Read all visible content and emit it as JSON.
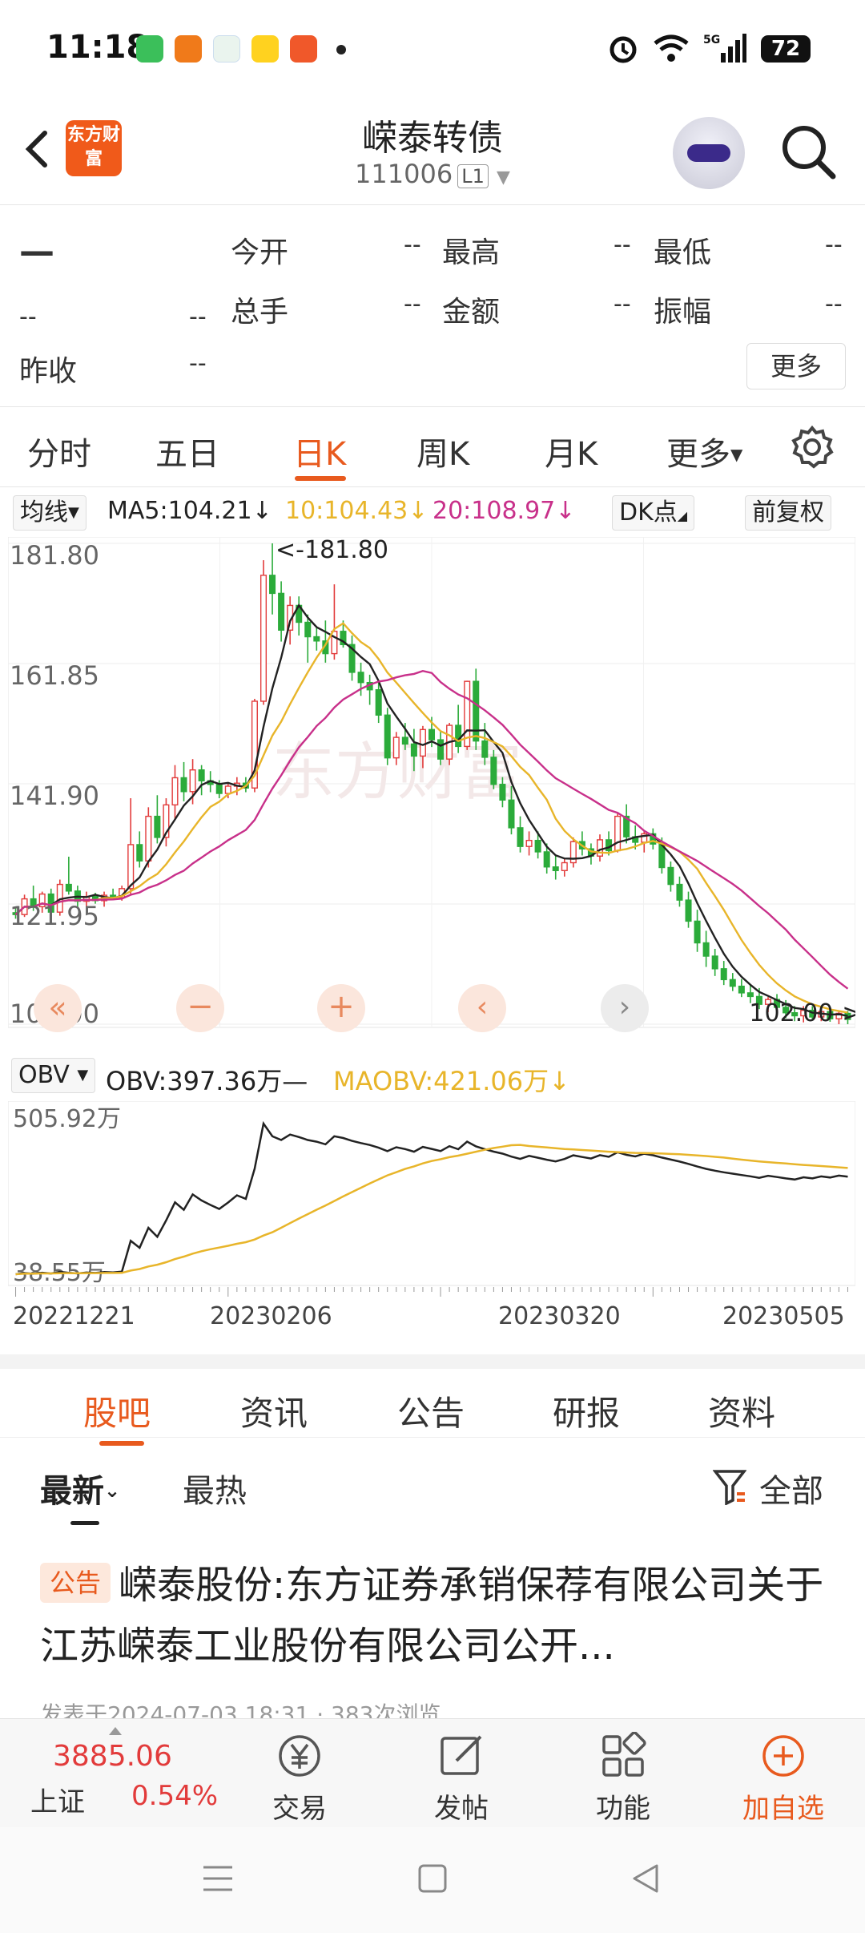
{
  "status": {
    "time": "11:18",
    "battery": "72",
    "network": "5G"
  },
  "header": {
    "title": "嵘泰转债",
    "code": "111006",
    "level": "L1",
    "logo_text": "东方财富"
  },
  "quote": {
    "price": "—",
    "change": "--",
    "change_pct": "--",
    "prev_close_label": "昨收",
    "prev_close": "--",
    "fields": [
      {
        "label": "今开",
        "value": "--"
      },
      {
        "label": "最高",
        "value": "--"
      },
      {
        "label": "最低",
        "value": "--"
      },
      {
        "label": "总手",
        "value": "--"
      },
      {
        "label": "金额",
        "value": "--"
      },
      {
        "label": "振幅",
        "value": "--"
      }
    ],
    "more_label": "更多"
  },
  "tabs": [
    "分时",
    "五日",
    "日K",
    "周K",
    "月K",
    "更多"
  ],
  "active_tab": "日K",
  "ma": {
    "selector": "均线",
    "ma5": "MA5:104.21",
    "ma10": "10:104.43",
    "ma20": "20:108.97",
    "dk": "DK点",
    "adjust": "前复权",
    "colors": {
      "ma5": "#222222",
      "ma10": "#e8b52a",
      "ma20": "#c8308a",
      "up": "#e23b3b",
      "down": "#2bab3a"
    }
  },
  "obv": {
    "selector": "OBV",
    "obv_text": "OBV:397.36万",
    "maobv_text": "MAOBV:421.06万",
    "y_top": "505.92万",
    "y_bottom": "38.55万"
  },
  "chart_data": {
    "type": "candlestick",
    "y_ticks": [
      "181.80",
      "161.85",
      "141.90",
      "121.95",
      "102.00"
    ],
    "ylim": [
      102.0,
      181.8
    ],
    "max_label": "181.80",
    "min_label": "102.00",
    "x_labels": [
      "20221221",
      "20230206",
      "20230320",
      "20230505"
    ],
    "candles": [
      [
        120.5,
        121.5,
        119.5,
        120.2
      ],
      [
        120.2,
        123.5,
        119.8,
        122.8
      ],
      [
        122.8,
        125,
        120.8,
        121.5
      ],
      [
        121.5,
        124,
        120.5,
        123.6
      ],
      [
        123.6,
        124.5,
        119.6,
        120.6
      ],
      [
        120.6,
        126,
        120,
        125.2
      ],
      [
        125.2,
        129.8,
        123.5,
        124.1
      ],
      [
        124.1,
        125,
        121.2,
        122.4
      ],
      [
        122.4,
        124,
        121.5,
        123.2
      ],
      [
        123.2,
        123.8,
        122,
        122.5
      ],
      [
        122.5,
        124,
        121.5,
        123.4
      ],
      [
        123.4,
        124.5,
        122.8,
        123.0
      ],
      [
        123.0,
        125,
        122.5,
        124.5
      ],
      [
        124.5,
        139.5,
        123.5,
        131.8
      ],
      [
        131.8,
        134,
        128,
        129.1
      ],
      [
        129.1,
        138,
        128,
        136.5
      ],
      [
        136.5,
        140,
        132,
        133.0
      ],
      [
        133.0,
        139.5,
        131.5,
        138.4
      ],
      [
        138.4,
        145,
        136,
        142.9
      ],
      [
        142.9,
        145.5,
        139,
        140.6
      ],
      [
        140.6,
        146,
        138.5,
        144.2
      ],
      [
        144.2,
        145,
        140,
        142.4
      ],
      [
        142.4,
        144,
        140.5,
        141.8
      ],
      [
        141.8,
        142.5,
        139.5,
        140.3
      ],
      [
        140.3,
        142,
        139.5,
        141.5
      ],
      [
        141.5,
        143,
        140,
        142.0
      ],
      [
        142.0,
        143,
        140.5,
        141.2
      ],
      [
        141.2,
        156,
        140.5,
        155.6
      ],
      [
        155.6,
        179,
        155,
        176.5
      ],
      [
        176.5,
        181.8,
        170,
        173.5
      ],
      [
        173.5,
        175.5,
        165.5,
        167.4
      ],
      [
        167.4,
        173,
        165,
        171.5
      ],
      [
        171.5,
        173,
        166.5,
        168.7
      ],
      [
        168.7,
        170,
        162,
        166.3
      ],
      [
        166.3,
        168,
        164,
        165.6
      ],
      [
        165.6,
        169,
        162,
        163.5
      ],
      [
        163.5,
        175,
        162.5,
        167.2
      ],
      [
        167.2,
        169,
        164.5,
        165.0
      ],
      [
        165.0,
        166.5,
        159,
        160.4
      ],
      [
        160.4,
        162,
        156.5,
        158.7
      ],
      [
        158.7,
        160,
        155,
        157.5
      ],
      [
        157.5,
        159,
        152,
        153.3
      ],
      [
        153.3,
        154.5,
        145,
        146.2
      ],
      [
        146.2,
        150.5,
        145,
        149.6
      ],
      [
        149.6,
        152,
        147.5,
        148.5
      ],
      [
        148.5,
        151,
        144,
        146.5
      ],
      [
        146.5,
        151.5,
        144.5,
        150.9
      ],
      [
        150.9,
        153,
        148,
        149.2
      ],
      [
        149.2,
        150.5,
        145,
        146.0
      ],
      [
        146.0,
        152,
        145,
        151.6
      ],
      [
        151.6,
        155,
        147,
        148.1
      ],
      [
        148.1,
        159,
        147.5,
        158.9
      ],
      [
        158.9,
        161,
        147.5,
        149.0
      ],
      [
        149.0,
        152,
        145,
        146.3
      ],
      [
        146.3,
        147.5,
        141,
        141.8
      ],
      [
        141.8,
        143,
        138,
        139.2
      ],
      [
        139.2,
        141.5,
        133.5,
        134.6
      ],
      [
        134.6,
        136.5,
        130.5,
        131.5
      ],
      [
        131.5,
        134,
        130,
        132.5
      ],
      [
        132.5,
        134,
        129.5,
        130.6
      ],
      [
        130.6,
        132,
        127,
        128.1
      ],
      [
        128.1,
        130,
        126,
        127.5
      ],
      [
        127.5,
        129.5,
        126.5,
        128.8
      ],
      [
        128.8,
        133,
        128,
        132.3
      ],
      [
        132.3,
        134,
        130,
        131.1
      ],
      [
        131.1,
        132,
        128.5,
        129.9
      ],
      [
        129.9,
        133.5,
        129,
        132.6
      ],
      [
        132.6,
        134,
        130,
        130.8
      ],
      [
        130.8,
        137,
        130.5,
        136.5
      ],
      [
        136.5,
        138.5,
        132,
        133.1
      ],
      [
        133.1,
        135,
        131,
        132.2
      ],
      [
        132.2,
        134,
        130.5,
        133.6
      ],
      [
        133.6,
        134.5,
        131,
        131.9
      ],
      [
        131.9,
        133,
        127,
        128.0
      ],
      [
        128.0,
        129,
        124,
        125.2
      ],
      [
        125.2,
        126.5,
        121.5,
        122.6
      ],
      [
        122.6,
        124,
        118,
        119.1
      ],
      [
        119.1,
        121,
        114,
        115.5
      ],
      [
        115.5,
        117.5,
        111.5,
        113.3
      ],
      [
        113.3,
        114.5,
        110,
        111.2
      ],
      [
        111.2,
        112.5,
        108.5,
        109.4
      ],
      [
        109.4,
        110.5,
        107.5,
        108.3
      ],
      [
        108.3,
        109.5,
        106.5,
        107.2
      ],
      [
        107.2,
        108.5,
        105.5,
        106.6
      ],
      [
        106.6,
        108,
        104.5,
        105.3
      ],
      [
        105.3,
        106.5,
        104,
        106.1
      ],
      [
        106.1,
        107,
        104,
        104.8
      ],
      [
        104.8,
        106,
        103,
        103.9
      ],
      [
        103.9,
        105,
        102.5,
        103.4
      ],
      [
        103.4,
        105,
        102.3,
        104.3
      ],
      [
        104.3,
        105,
        102.8,
        103.2
      ],
      [
        103.2,
        104.8,
        102.5,
        104.1
      ],
      [
        104.1,
        104.8,
        102.4,
        102.9
      ],
      [
        102.9,
        104.2,
        102.0,
        103.8
      ],
      [
        103.8,
        104.2,
        102.0,
        102.8
      ]
    ]
  },
  "sections": [
    "股吧",
    "资讯",
    "公告",
    "研报",
    "资料"
  ],
  "filters": {
    "latest": "最新",
    "hot": "最热",
    "all": "全部"
  },
  "post": {
    "tag": "公告",
    "title": "嵘泰股份:东方证券承销保荐有限公司关于江苏嵘泰工业股份有限公司公开...",
    "meta": "发表于2024-07-03 18:31 · 383次浏览"
  },
  "bottom_bar": {
    "index_value": "3885.06",
    "index_name": "上证",
    "index_change": "0.54%",
    "items": [
      "交易",
      "发帖",
      "功能",
      "加自选"
    ]
  }
}
